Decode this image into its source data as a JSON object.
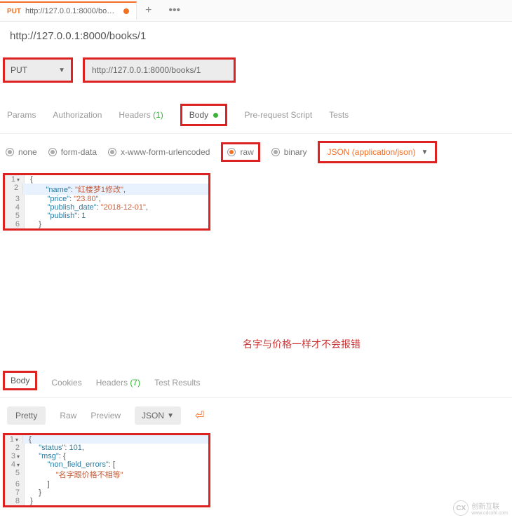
{
  "tab": {
    "method": "PUT",
    "label": "http://127.0.0.1:8000/books/"
  },
  "breadcrumb": "http://127.0.0.1:8000/books/1",
  "request": {
    "method": "PUT",
    "url": "http://127.0.0.1:8000/books/1"
  },
  "req_tabs": {
    "params": "Params",
    "auth": "Authorization",
    "headers": "Headers",
    "headers_count": "(1)",
    "body": "Body",
    "prereq": "Pre-request Script",
    "tests": "Tests"
  },
  "body_types": {
    "none": "none",
    "form": "form-data",
    "urlenc": "x-www-form-urlencoded",
    "raw": "raw",
    "binary": "binary",
    "content_type": "JSON (application/json)"
  },
  "req_body_lines": {
    "l1": "{",
    "l2_indent": "        ",
    "l2_k": "\"name\"",
    "l2_sep": ": ",
    "l2_v": "\"红楼梦1修改\"",
    "l2_end": ",",
    "l3_k": "\"price\"",
    "l3_v": "\"23.80\"",
    "l3_end": ",",
    "l4_k": "\"publish_date\"",
    "l4_v": "\"2018-12-01\"",
    "l4_end": ",",
    "l5_k": "\"publish\"",
    "l5_v": "1",
    "l6_indent": "    ",
    "l6": "}"
  },
  "annotation": "名字与价格一样才不会报错",
  "resp_tabs": {
    "body": "Body",
    "cookies": "Cookies",
    "headers": "Headers",
    "headers_count": "(7)",
    "tests": "Test Results"
  },
  "resp_format": {
    "pretty": "Pretty",
    "raw": "Raw",
    "preview": "Preview",
    "json": "JSON"
  },
  "resp_body_lines": {
    "l1": "{",
    "l2_indent": "    ",
    "l2_k": "\"status\"",
    "l2_v": "101",
    "l2_end": ",",
    "l3_k": "\"msg\"",
    "l3_v": "{",
    "l4_indent": "        ",
    "l4_k": "\"non_field_errors\"",
    "l4_v": "[",
    "l5_indent": "            ",
    "l5_v": "\"名字跟价格不相等\"",
    "l6_indent": "        ",
    "l6": "]",
    "l7_indent": "    ",
    "l7": "}",
    "l8": "}"
  },
  "watermark": {
    "text": "创新互联",
    "sub": "www.cdcxhl.com",
    "logo": "CX"
  }
}
